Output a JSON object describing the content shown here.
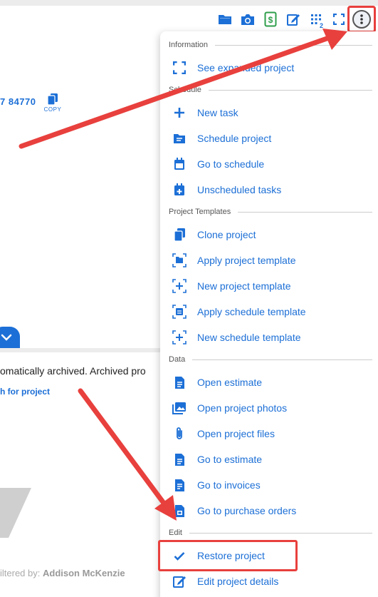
{
  "background": {
    "phone_fragment": "7 84770",
    "copy_label": "COPY",
    "archived_text": "omatically archived. Archived pro",
    "search_link": "h for project",
    "filtered_prefix": "iltered by:",
    "filtered_user": "Addison McKenzie"
  },
  "toolbar": {
    "icons": [
      "folder-icon",
      "camera-icon",
      "dollar-document-icon",
      "edit-icon",
      "grid-icon",
      "expand-icon",
      "more-vert-icon"
    ],
    "grid_badge": "2"
  },
  "menu": {
    "sections": [
      {
        "header": "Information",
        "items": [
          {
            "label": "See expanded project",
            "icon": "expand-icon"
          }
        ]
      },
      {
        "header": "Schedule",
        "items": [
          {
            "label": "New task",
            "icon": "plus-icon"
          },
          {
            "label": "Schedule project",
            "icon": "folder-lines-icon"
          },
          {
            "label": "Go to schedule",
            "icon": "calendar-icon"
          },
          {
            "label": "Unscheduled tasks",
            "icon": "calendar-plus-icon"
          }
        ]
      },
      {
        "header": "Project Templates",
        "items": [
          {
            "label": "Clone project",
            "icon": "copy-icon"
          },
          {
            "label": "Apply project template",
            "icon": "template-folder-icon"
          },
          {
            "label": "New project template",
            "icon": "template-plus-icon"
          },
          {
            "label": "Apply schedule template",
            "icon": "template-calendar-icon"
          },
          {
            "label": "New schedule template",
            "icon": "template-plus-icon"
          }
        ]
      },
      {
        "header": "Data",
        "items": [
          {
            "label": "Open estimate",
            "icon": "document-icon"
          },
          {
            "label": "Open project photos",
            "icon": "photos-icon"
          },
          {
            "label": "Open project files",
            "icon": "paperclip-icon"
          },
          {
            "label": "Go to estimate",
            "icon": "document-icon"
          },
          {
            "label": "Go to invoices",
            "icon": "invoice-icon"
          },
          {
            "label": "Go to purchase orders",
            "icon": "purchase-order-icon"
          }
        ]
      },
      {
        "header": "Edit",
        "items": [
          {
            "label": "Restore project",
            "icon": "check-icon"
          },
          {
            "label": "Edit project details",
            "icon": "edit-icon"
          }
        ]
      }
    ]
  },
  "colors": {
    "accent": "#1c6fd6",
    "annotation": "#e8403d"
  }
}
